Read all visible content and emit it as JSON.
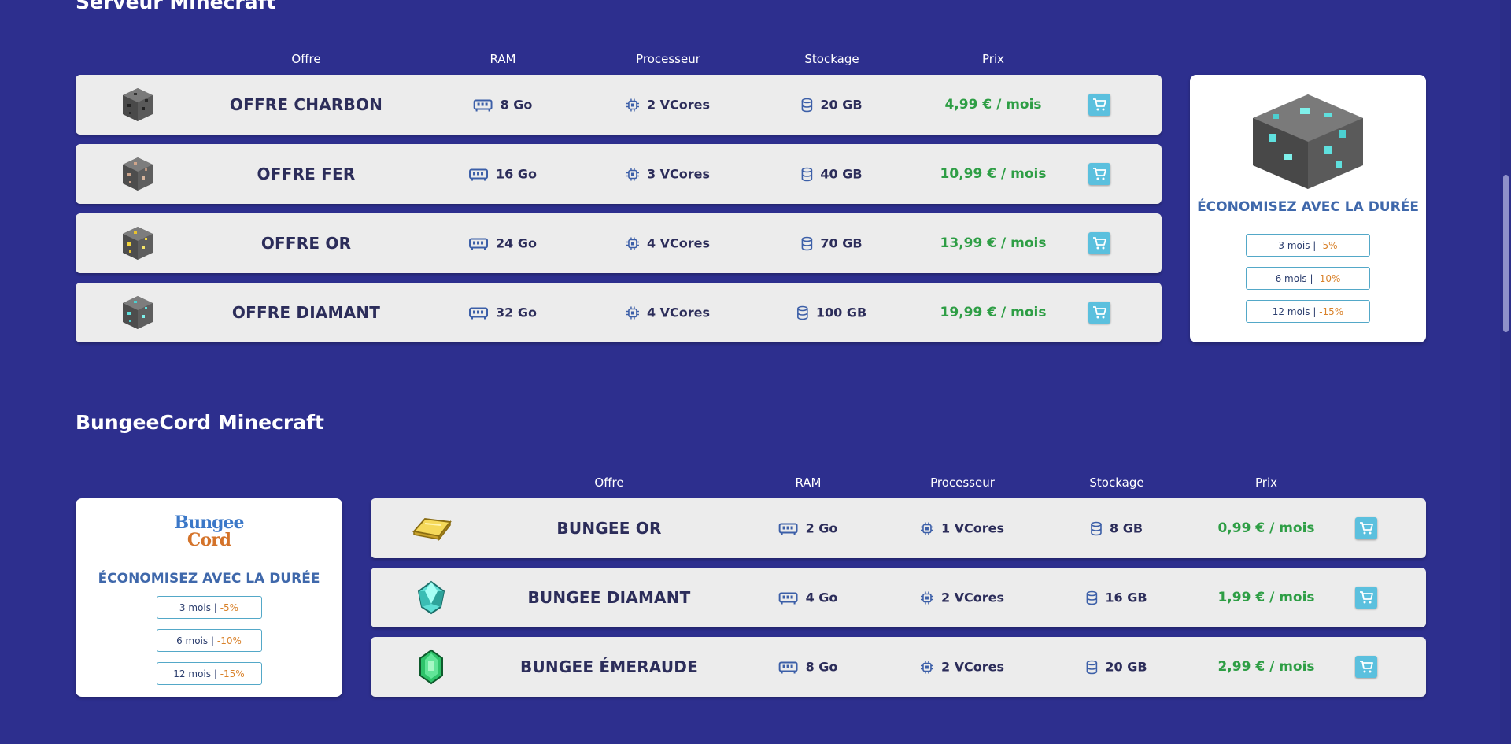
{
  "sections": {
    "minecraft": {
      "title": "Serveur Minecraft"
    },
    "bungee": {
      "title": "BungeeCord Minecraft"
    }
  },
  "columns": {
    "offer": "Offre",
    "ram": "RAM",
    "cpu": "Processeur",
    "storage": "Stockage",
    "price": "Prix"
  },
  "minecraft_offers": [
    {
      "name": "OFFRE CHARBON",
      "ram": "8 Go",
      "cpu": "2 VCores",
      "storage": "20 GB",
      "price": "4,99 € / mois",
      "icon": "coal-ore-block-icon"
    },
    {
      "name": "OFFRE FER",
      "ram": "16 Go",
      "cpu": "3 VCores",
      "storage": "40 GB",
      "price": "10,99 € / mois",
      "icon": "iron-ore-block-icon"
    },
    {
      "name": "OFFRE OR",
      "ram": "24 Go",
      "cpu": "4 VCores",
      "storage": "70 GB",
      "price": "13,99 € / mois",
      "icon": "gold-ore-block-icon"
    },
    {
      "name": "OFFRE DIAMANT",
      "ram": "32 Go",
      "cpu": "4 VCores",
      "storage": "100 GB",
      "price": "19,99 € / mois",
      "icon": "diamond-ore-block-icon"
    }
  ],
  "bungee_offers": [
    {
      "name": "BUNGEE OR",
      "ram": "2 Go",
      "cpu": "1 VCores",
      "storage": "8 GB",
      "price": "0,99 € / mois",
      "icon": "gold-ingot-icon"
    },
    {
      "name": "BUNGEE DIAMANT",
      "ram": "4 Go",
      "cpu": "2 VCores",
      "storage": "16 GB",
      "price": "1,99 € / mois",
      "icon": "diamond-gem-icon"
    },
    {
      "name": "BUNGEE ÉMERAUDE",
      "ram": "8 Go",
      "cpu": "2 VCores",
      "storage": "20 GB",
      "price": "2,99 € / mois",
      "icon": "emerald-gem-icon"
    }
  ],
  "save_card": {
    "title": "ÉCONOMISEZ AVEC LA DURÉE",
    "options": [
      {
        "period": "3 mois | ",
        "discount": "-5%"
      },
      {
        "period": "6 mois | ",
        "discount": "-10%"
      },
      {
        "period": "12 mois | ",
        "discount": "-15%"
      }
    ]
  },
  "bungee_logo": {
    "line1": "Bungee",
    "line2": "Cord"
  },
  "colors": {
    "background": "#2d2f8e",
    "row": "#ececec",
    "price": "#2e9e45",
    "cart": "#5bc0de",
    "save_title": "#3f68ab",
    "discount": "#d9822b"
  }
}
